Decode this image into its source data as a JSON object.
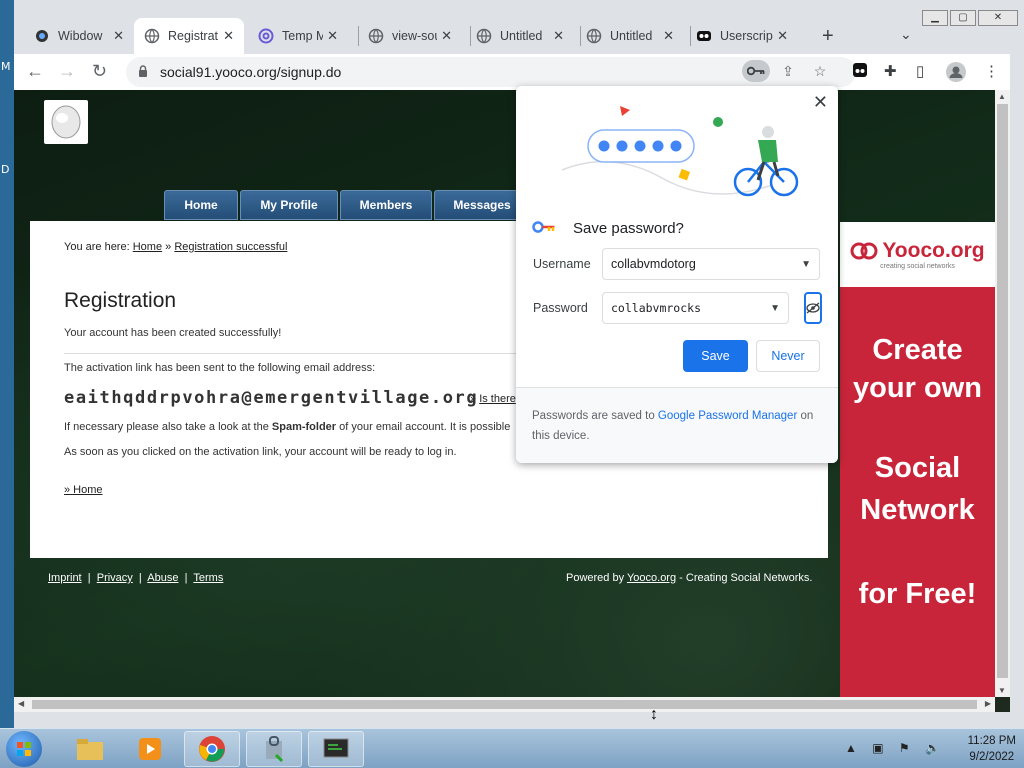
{
  "desktop": {
    "edge_glyphs": [
      "M",
      "D"
    ]
  },
  "browser": {
    "tabs": [
      {
        "title": "Wibdow",
        "icon": "wibdow-favicon"
      },
      {
        "title": "Registrat",
        "icon": "globe-icon",
        "active": true
      },
      {
        "title": "Temp M",
        "icon": "temp-mail-icon"
      },
      {
        "title": "view-sou",
        "icon": "globe-icon"
      },
      {
        "title": "Untitled",
        "icon": "globe-icon"
      },
      {
        "title": "Untitled",
        "icon": "globe-icon"
      },
      {
        "title": "Userscrip",
        "icon": "userscript-icon"
      }
    ],
    "new_tab": "+",
    "url": "social91.yooco.org/signup.do"
  },
  "site": {
    "nav": [
      "Home",
      "My Profile",
      "Members",
      "Messages"
    ],
    "breadcrumb": {
      "prefix": "You are here:",
      "home": "Home",
      "sep": "»",
      "current": "Registration successful"
    },
    "heading": "Registration",
    "created": "Your account has been created successfully!",
    "activation_intro": "The activation link has been sent to the following email address:",
    "email": "eaithqddrpvohra@emergentvillage.org",
    "is_there": "Is there",
    "is_there_prefix": "»",
    "spam_pre": "If necessary please also take a look at the ",
    "spam_bold": "Spam-folder",
    "spam_post": " of your email account. It is possible",
    "ready": "As soon as you clicked on the activation link, your account will be ready to log in.",
    "home_link": "» Home",
    "footer_links": [
      "Imprint",
      "Privacy",
      "Abuse",
      "Terms"
    ],
    "footer_sep": "|",
    "powered_pre": "Powered by ",
    "powered_link": "Yooco.org",
    "powered_post": " - Creating Social Networks."
  },
  "ad": {
    "logo": "Yooco.org",
    "logo_sub": "creating social networks",
    "lines": [
      "Create",
      "your own",
      "",
      "Social",
      "Network",
      "",
      "for Free!"
    ]
  },
  "save_password": {
    "title": "Save password?",
    "username_label": "Username",
    "username_value": "collabvmdotorg",
    "password_label": "Password",
    "password_value": "collabvmrocks",
    "save": "Save",
    "never": "Never",
    "footer_pre": "Passwords are saved to ",
    "footer_link": "Google Password Manager",
    "footer_post": " on this device."
  },
  "taskbar": {
    "time": "11:28 PM",
    "date": "9/2/2022"
  },
  "colors": {
    "accent": "#1a73e8",
    "ad_red": "#c8253a",
    "nav_blue": "#2f5c8a"
  }
}
